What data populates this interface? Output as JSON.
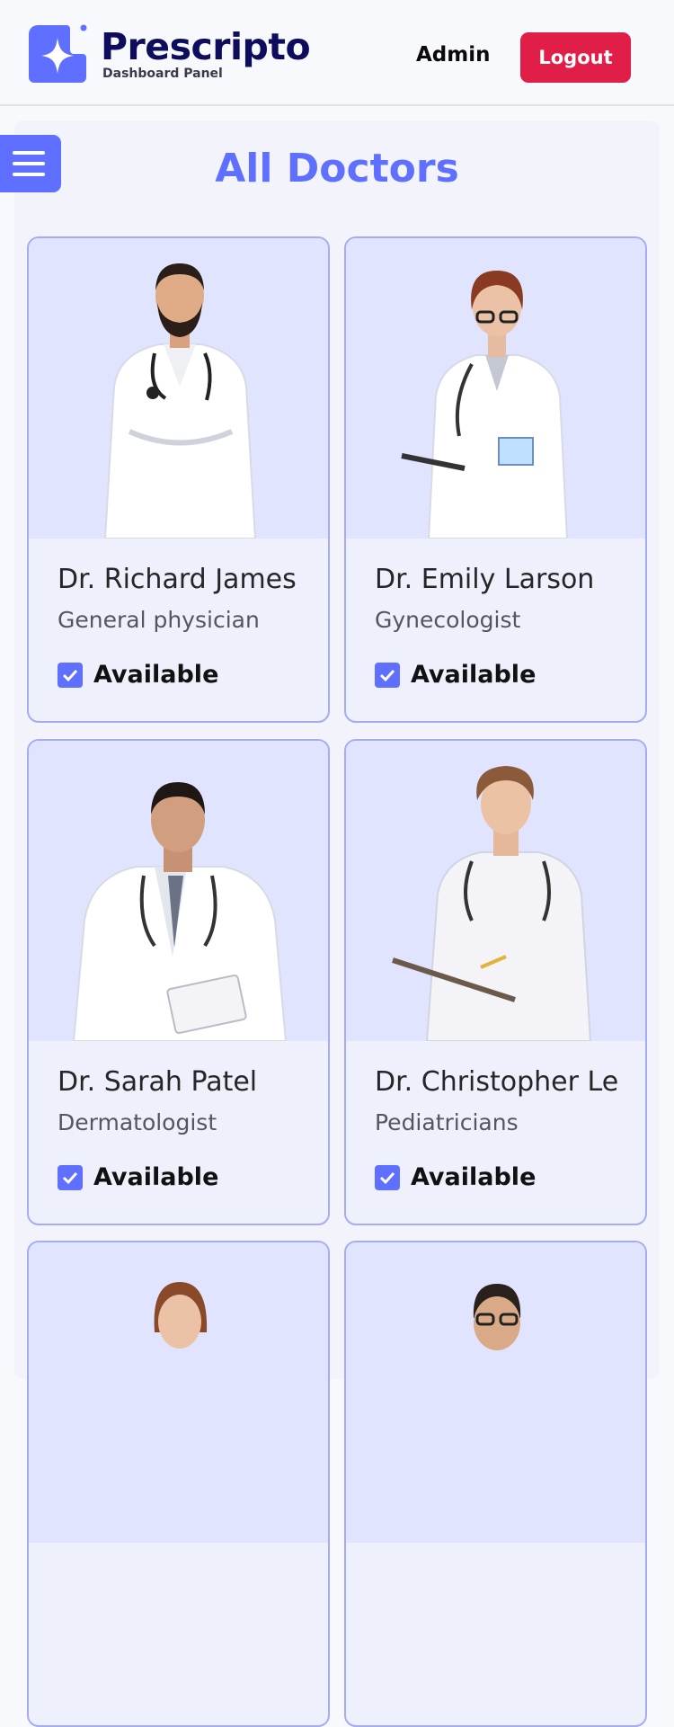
{
  "header": {
    "logo_title": "Prescripto",
    "logo_subtitle": "Dashboard Panel",
    "role": "Admin",
    "logout_label": "Logout"
  },
  "page": {
    "title": "All Doctors"
  },
  "doctors": [
    {
      "name": "Dr. Richard James",
      "speciality": "General physician",
      "available": true,
      "available_label": "Available"
    },
    {
      "name": "Dr. Emily Larson",
      "speciality": "Gynecologist",
      "available": true,
      "available_label": "Available"
    },
    {
      "name": "Dr. Sarah Patel",
      "speciality": "Dermatologist",
      "available": true,
      "available_label": "Available"
    },
    {
      "name": "Dr. Christopher Lee",
      "speciality": "Pediatricians",
      "available": true,
      "available_label": "Available"
    }
  ],
  "colors": {
    "accent": "#5f6fff",
    "logout": "#e01e47",
    "brand_dark": "#0e0c5d",
    "photo_bg": "#e1e4ff"
  }
}
